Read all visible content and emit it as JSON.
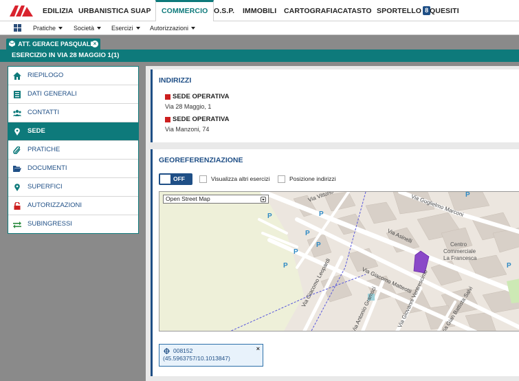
{
  "topnav": {
    "items": [
      "EDILIZIA",
      "URBANISTICA",
      "SUAP",
      "COMMERCIO",
      "O.S.P.",
      "IMMOBILI",
      "CARTOGRAFIA",
      "CATASTO",
      "SPORTELLO",
      "QUESITI"
    ],
    "active": "COMMERCIO",
    "sportello_badge": "8",
    "accent_color": "#0e7a7b"
  },
  "subnav": {
    "items": [
      "Pratiche",
      "Società",
      "Esercizi",
      "Autorizzazioni"
    ]
  },
  "record": {
    "tab_label": "ATT. GERACE PASQUALE",
    "title": "ESERCIZIO IN VIA 28 MAGGIO 1(1)"
  },
  "sidebar": {
    "items": [
      {
        "label": "RIEPILOGO",
        "icon": "home-icon"
      },
      {
        "label": "DATI GENERALI",
        "icon": "list-icon"
      },
      {
        "label": "CONTATTI",
        "icon": "users-icon"
      },
      {
        "label": "SEDE",
        "icon": "map-marker-icon"
      },
      {
        "label": "PRATICHE",
        "icon": "paperclip-icon"
      },
      {
        "label": "DOCUMENTI",
        "icon": "folder-open-icon"
      },
      {
        "label": "SUPERFICI",
        "icon": "map-marker-icon"
      },
      {
        "label": "AUTORIZZAZIONI",
        "icon": "lock-icon"
      },
      {
        "label": "SUBINGRESSI",
        "icon": "exchange-icon"
      }
    ],
    "active": "SEDE"
  },
  "indirizzi": {
    "title": "INDIRIZZI",
    "sedi": [
      {
        "name": "SEDE OPERATIVA",
        "address": "Via 28 Maggio, 1"
      },
      {
        "name": "SEDE OPERATIVA",
        "address": "Via Manzoni, 74"
      }
    ]
  },
  "geo": {
    "title": "GEOREFERENZIAZIONE",
    "toggle_label": "OFF",
    "checkbox_altri": "Visualizza altri esercizi",
    "checkbox_posizione": "Posizione indirizzi",
    "map_layer": "Open Street Map",
    "map_labels": {
      "vittorio_veneto": "Via Vittorio Veneto",
      "guglielmo_marconi": "Via Guglielmo Marconi",
      "asinelli": "Via Asinelli",
      "centro": "Centro",
      "commerciale": "Commerciale",
      "francesca": "La Francesca",
      "leopardi": "Via Giacomo Leopardi",
      "matteotti": "Via Giacomo Matteotti",
      "gramsci": "Via Antonio Gramsci",
      "venturi": "Via Giovanni Ventrescimo",
      "salvi": "Via Gian Battista Salvi",
      "parking": "P"
    },
    "coord_id": "008152",
    "coord_value": "(45.5963757/10.1013847)"
  }
}
